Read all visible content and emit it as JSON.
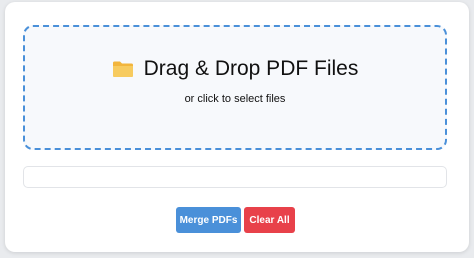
{
  "dropzone": {
    "title": "Drag & Drop PDF Files",
    "subtitle": "or click to select files",
    "icon": "folder-icon"
  },
  "actions": {
    "merge_label": "Merge PDFs",
    "clear_label": "Clear All"
  },
  "colors": {
    "accent": "#4a90d9",
    "danger": "#e8414a",
    "folder": "#f5c04d"
  }
}
